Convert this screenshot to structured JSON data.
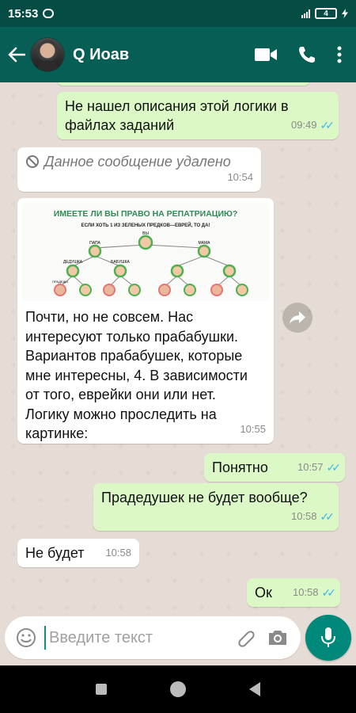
{
  "status": {
    "time": "15:53",
    "battery": "4"
  },
  "header": {
    "contact_name": "Q Иоав"
  },
  "messages": [
    {
      "id": "m1",
      "text": "Не нашел описания этой логики в файлах заданий",
      "time": "09:49",
      "direction": "out"
    },
    {
      "id": "m2",
      "text": "Данное сообщение удалено",
      "time": "10:54",
      "direction": "in"
    },
    {
      "id": "m3",
      "direction": "in",
      "time": "10:55",
      "image": {
        "title": "ИМЕЕТЕ ЛИ ВЫ ПРАВО НА РЕПАТРИАЦИЮ?",
        "subtitle": "ЕСЛИ ХОТЬ 1 ИЗ ЗЕЛЕНЫХ ПРЕДКОВ—ЕВРЕЙ, ТО ДА!",
        "me": "ВЫ",
        "dad": "ПАПА",
        "mom": "МАМА",
        "grandpa": "ДЕДУШКА",
        "grandma": "БАБУШКА",
        "great": "ПРАДЕДЫ"
      },
      "text": "Почти, но не совсем. Нас интересуют только прабабушки. Вариантов прабабушек, которые мне интересны, 4. В зависимости от того, еврейки они или нет. Логику можно проследить на картинке:"
    },
    {
      "id": "m4",
      "text": "Понятно",
      "time": "10:57",
      "direction": "out"
    },
    {
      "id": "m5",
      "text": "Прадедушек не будет вообще?",
      "time": "10:58",
      "direction": "out"
    },
    {
      "id": "m6",
      "text": "Не будет",
      "time": "10:58",
      "direction": "in"
    },
    {
      "id": "m7",
      "text": "Ок",
      "time": "10:58",
      "direction": "out"
    }
  ],
  "composer": {
    "placeholder": "Введите текст"
  },
  "colors": {
    "header": "#075e54",
    "outgoing": "#dcf8c6",
    "read_ticks": "#34b7f1",
    "fab": "#00897b"
  }
}
